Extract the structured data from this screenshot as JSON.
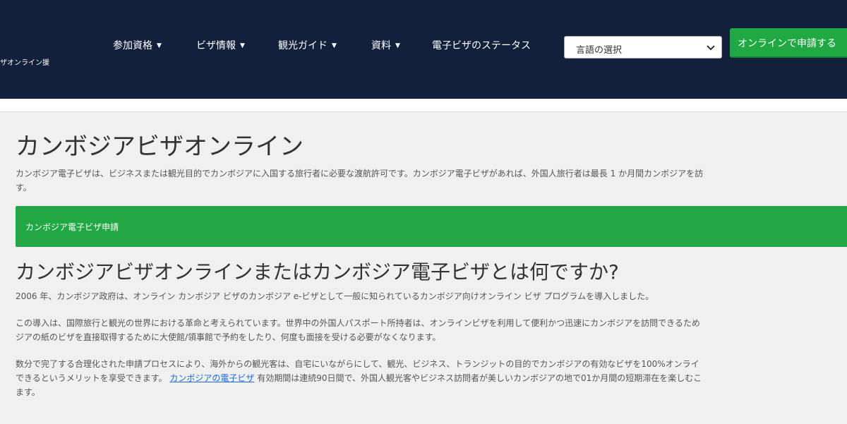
{
  "header": {
    "logo_text": "ザオンライン援",
    "nav": [
      {
        "label": "参加資格"
      },
      {
        "label": "ビザ情報"
      },
      {
        "label": "観光ガイド"
      },
      {
        "label": "資料"
      },
      {
        "label": "電子ビザのステータス"
      }
    ],
    "language_select": {
      "value": "言語の選択"
    },
    "apply_button": "オンラインで申請する"
  },
  "main": {
    "title": "カンボジアビザオンライン",
    "intro_line1": "カンボジア電子ビザは、ビジネスまたは観光目的でカンボジアに入国する旅行者に必要な渡航許可です。カンボジア電子ビザがあれば、外国人旅行者は最長 1 か月間カンボジアを訪",
    "intro_line2": "す。",
    "apply_bar": "カンボジア電子ビザ申請",
    "section_title": "カンボジアビザオンラインまたはカンボジア電子ビザとは何ですか?",
    "para1": "2006 年、カンボジア政府は、オンライン カンボジア ビザのカンボジア e-ビザとして一般に知られているカンボジア向けオンライン ビザ プログラムを導入しました。",
    "para2_line1": "この導入は、国際旅行と観光の世界における革命と考えられています。世界中の外国人パスポート所持者は、オンラインビザを利用して便利かつ迅速にカンボジアを訪問できるため",
    "para2_line2": "ジアの紙のビザを直接取得するために大使館/領事館で予約をしたり、何度も面接を受ける必要がなくなります。",
    "para3_line1": "数分で完了する合理化された申請プロセスにより、海外からの観光客は、自宅にいながらにして、観光、ビジネス、トランジットの目的でカンボジアの有効なビザを100%オンライ",
    "para3_line2_a": "できるというメリットを享受できます。",
    "para3_link": "カンボジアの電子ビザ",
    "para3_line2_b": "有効期間は連続90日間で、外国人観光客やビジネス訪問者が美しいカンボジアの地で01か月間の短期滞在を楽しむこ",
    "para3_line3": "ます。"
  },
  "colors": {
    "header_bg": "#13203b",
    "accent_green": "#21a743",
    "link": "#1a6bd1"
  }
}
